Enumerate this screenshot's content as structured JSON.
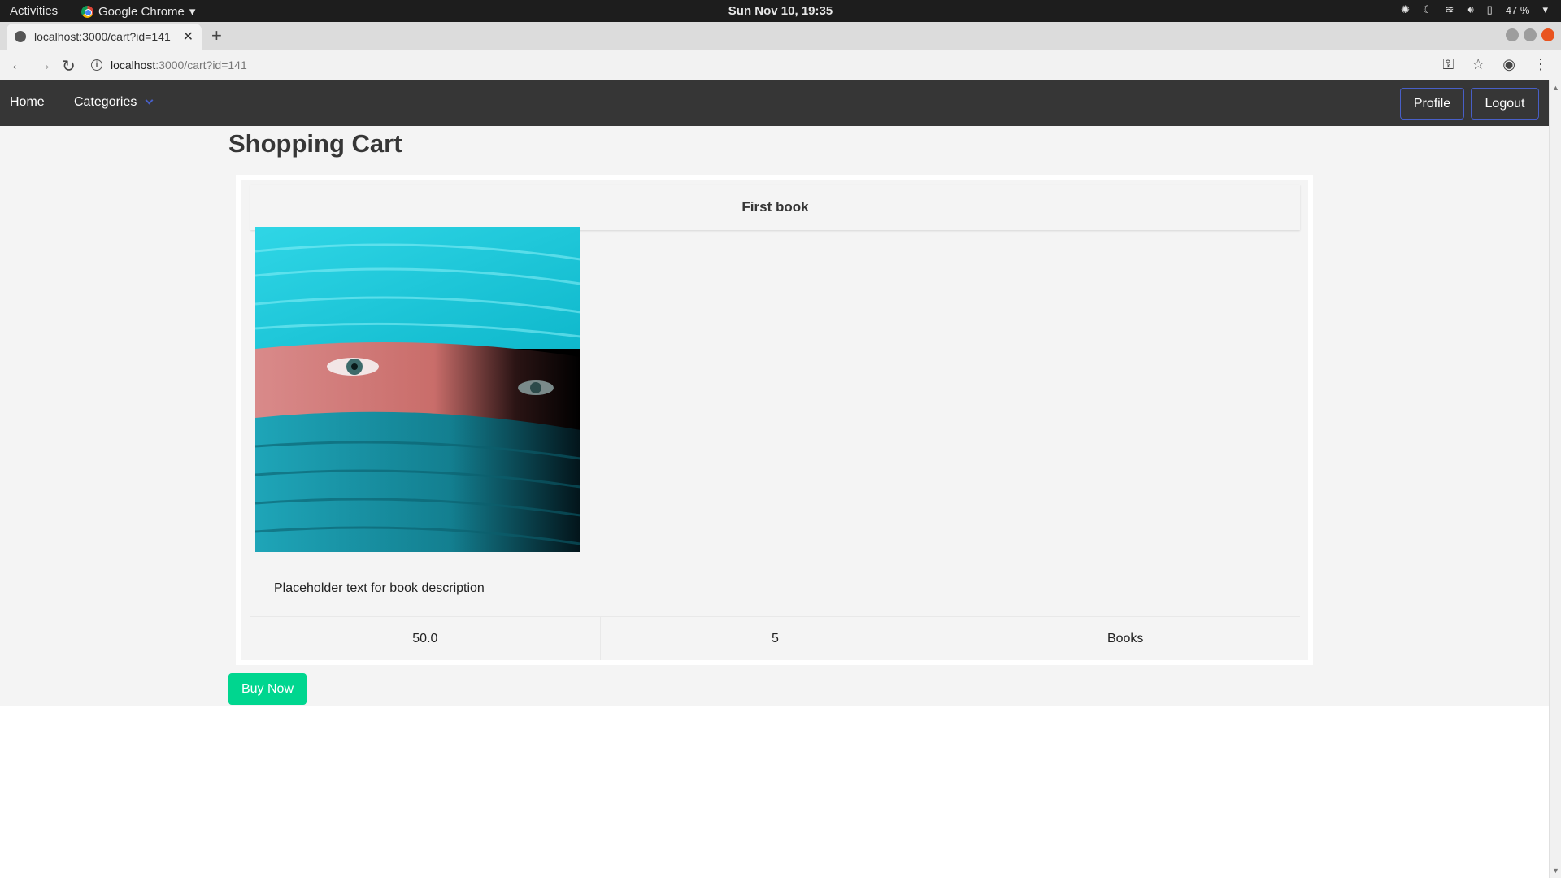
{
  "os": {
    "activities": "Activities",
    "app_name": "Google Chrome",
    "clock": "Sun Nov 10, 19:35",
    "battery": "47 %"
  },
  "browser": {
    "tab_title": "localhost:3000/cart?id=141",
    "url_host": "localhost",
    "url_path": ":3000/cart?id=141"
  },
  "navbar": {
    "home": "Home",
    "categories": "Categories",
    "profile": "Profile",
    "logout": "Logout"
  },
  "page": {
    "title": "Shopping Cart"
  },
  "cart_item": {
    "name": "First book",
    "description": "Placeholder text for book description",
    "price": "50.0",
    "quantity": "5",
    "category": "Books"
  },
  "actions": {
    "buy_now": "Buy Now"
  },
  "colors": {
    "navbar_bg": "#363636",
    "accent": "#485fc7",
    "buy_button": "#00d68f",
    "content_bg": "#f4f4f4"
  }
}
